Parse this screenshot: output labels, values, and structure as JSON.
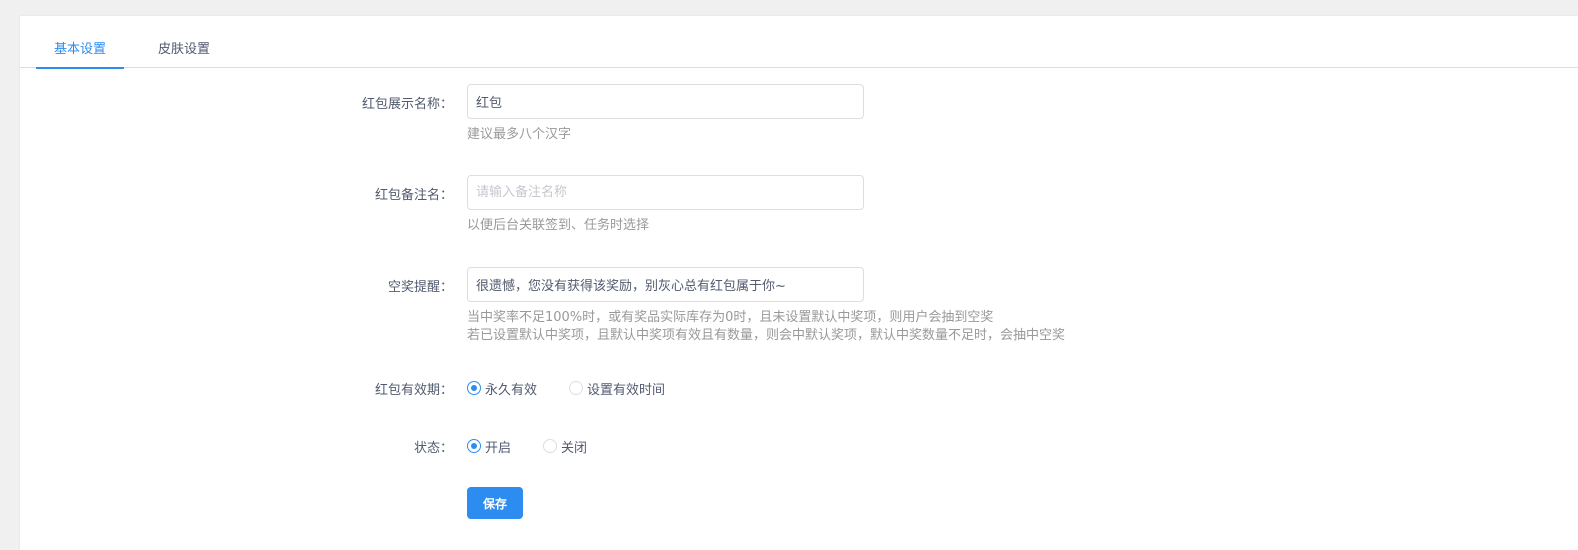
{
  "tabs": [
    {
      "label": "基本设置",
      "active": true
    },
    {
      "label": "皮肤设置",
      "active": false
    }
  ],
  "form": {
    "display_name": {
      "label": "红包展示名称：",
      "value": "红包",
      "hint": "建议最多八个汉字"
    },
    "remark_name": {
      "label": "红包备注名：",
      "placeholder": "请输入备注名称",
      "hint": "以便后台关联签到、任务时选择"
    },
    "empty_prize_tip": {
      "label": "空奖提醒：",
      "value": "很遗憾，您没有获得该奖励，别灰心总有红包属于你~",
      "hint_line1": "当中奖率不足100%时，或有奖品实际库存为0时，且未设置默认中奖项，则用户会抽到空奖",
      "hint_line2": "若已设置默认中奖项，且默认中奖项有效且有数量，则会中默认奖项，默认中奖数量不足时，会抽中空奖"
    },
    "validity": {
      "label": "红包有效期：",
      "options": [
        "永久有效",
        "设置有效时间"
      ],
      "selected": "永久有效"
    },
    "status": {
      "label": "状态：",
      "options": [
        "开启",
        "关闭"
      ],
      "selected": "开启"
    }
  },
  "actions": {
    "save_label": "保存"
  },
  "colors": {
    "primary": "#2d8cf0",
    "text": "#515a6e",
    "hint": "#999999",
    "border": "#dcdee2"
  }
}
